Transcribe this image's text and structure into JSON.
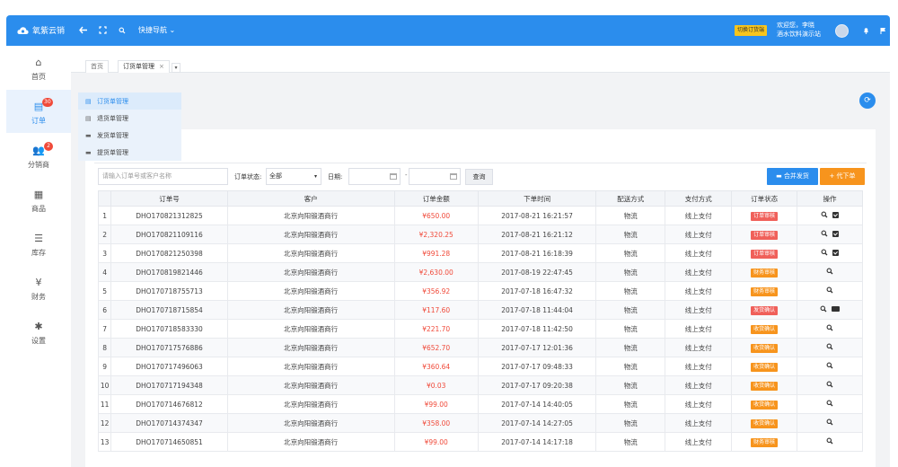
{
  "app": {
    "brand": "氧紫云销",
    "quick_nav": "快捷导航",
    "switch_label": "切换订货端",
    "welcome_line1": "欢迎您，李晓",
    "welcome_line2": "酒水饮料演示站"
  },
  "sidebar": {
    "items": [
      {
        "label": "首页",
        "icon": "home-icon",
        "glyph": "⌂"
      },
      {
        "label": "订单",
        "icon": "order-icon",
        "glyph": "▤",
        "badge": "30"
      },
      {
        "label": "分销商",
        "icon": "distributor-icon",
        "glyph": "👥",
        "badge": "2"
      },
      {
        "label": "商品",
        "icon": "goods-icon",
        "glyph": "▦"
      },
      {
        "label": "库存",
        "icon": "inventory-icon",
        "glyph": "☰"
      },
      {
        "label": "财务",
        "icon": "finance-icon",
        "glyph": "¥"
      },
      {
        "label": "设置",
        "icon": "settings-icon",
        "glyph": "✱"
      }
    ]
  },
  "flyout": {
    "items": [
      {
        "label": "订货单管理",
        "glyph": "▤"
      },
      {
        "label": "退货单管理",
        "glyph": "▤"
      },
      {
        "label": "发货单管理",
        "glyph": "▬"
      },
      {
        "label": "提货单管理",
        "glyph": "▬"
      }
    ]
  },
  "tabs": {
    "home": "首页",
    "current": "订货单管理",
    "close": "×",
    "dropdown": "▾"
  },
  "filters": {
    "search_placeholder": "请输入订单号或客户名称",
    "status_label": "订单状态:",
    "status_value": "全部",
    "date_label": "日期:",
    "dash": "-",
    "query": "查询",
    "merge_ship": "合并发货",
    "proxy_order": "+ 代下单"
  },
  "table": {
    "headers": [
      "",
      "订单号",
      "客户",
      "订单金额",
      "下单时间",
      "配送方式",
      "支付方式",
      "订单状态",
      "操作"
    ],
    "rows": [
      {
        "idx": "1",
        "order_no": "DHO170821312825",
        "customer": "北京向阳锻酒商行",
        "amount": "¥650.00",
        "time": "2017-08-21 16:21:57",
        "delivery": "物流",
        "payment": "线上支付",
        "status": "订单审核",
        "status_color": "#f0605a",
        "ops": [
          "view",
          "check"
        ]
      },
      {
        "idx": "2",
        "order_no": "DHO170821109116",
        "customer": "北京向阳锻酒商行",
        "amount": "¥2,320.25",
        "time": "2017-08-21 16:21:12",
        "delivery": "物流",
        "payment": "线上支付",
        "status": "订单审核",
        "status_color": "#f0605a",
        "ops": [
          "view",
          "check"
        ]
      },
      {
        "idx": "3",
        "order_no": "DHO170821250398",
        "customer": "北京向阳锻酒商行",
        "amount": "¥991.28",
        "time": "2017-08-21 16:18:39",
        "delivery": "物流",
        "payment": "线上支付",
        "status": "订单审核",
        "status_color": "#f0605a",
        "ops": [
          "view",
          "check"
        ]
      },
      {
        "idx": "4",
        "order_no": "DHO170819821446",
        "customer": "北京向阳锻酒商行",
        "amount": "¥2,630.00",
        "time": "2017-08-19 22:47:45",
        "delivery": "物流",
        "payment": "线上支付",
        "status": "财务审核",
        "status_color": "#f7941d",
        "ops": [
          "view"
        ]
      },
      {
        "idx": "5",
        "order_no": "DHO170718755713",
        "customer": "北京向阳锻酒商行",
        "amount": "¥356.92",
        "time": "2017-07-18 16:47:32",
        "delivery": "物流",
        "payment": "线上支付",
        "status": "财务审核",
        "status_color": "#f7941d",
        "ops": [
          "view"
        ]
      },
      {
        "idx": "6",
        "order_no": "DHO170718715854",
        "customer": "北京向阳锻酒商行",
        "amount": "¥117.60",
        "time": "2017-07-18 11:44:04",
        "delivery": "物流",
        "payment": "线上支付",
        "status": "发货确认",
        "status_color": "#f0605a",
        "ops": [
          "view",
          "truck"
        ]
      },
      {
        "idx": "7",
        "order_no": "DHO170718583330",
        "customer": "北京向阳锻酒商行",
        "amount": "¥221.70",
        "time": "2017-07-18 11:42:50",
        "delivery": "物流",
        "payment": "线上支付",
        "status": "收货确认",
        "status_color": "#f7941d",
        "ops": [
          "view"
        ]
      },
      {
        "idx": "8",
        "order_no": "DHO170717576886",
        "customer": "北京向阳锻酒商行",
        "amount": "¥652.70",
        "time": "2017-07-17 12:01:36",
        "delivery": "物流",
        "payment": "线上支付",
        "status": "收货确认",
        "status_color": "#f7941d",
        "ops": [
          "view"
        ]
      },
      {
        "idx": "9",
        "order_no": "DHO170717496063",
        "customer": "北京向阳锻酒商行",
        "amount": "¥360.64",
        "time": "2017-07-17 09:48:33",
        "delivery": "物流",
        "payment": "线上支付",
        "status": "收货确认",
        "status_color": "#f7941d",
        "ops": [
          "view"
        ]
      },
      {
        "idx": "10",
        "order_no": "DHO170717194348",
        "customer": "北京向阳锻酒商行",
        "amount": "¥0.03",
        "time": "2017-07-17 09:20:38",
        "delivery": "物流",
        "payment": "线上支付",
        "status": "收货确认",
        "status_color": "#f7941d",
        "ops": [
          "view"
        ]
      },
      {
        "idx": "11",
        "order_no": "DHO170714676812",
        "customer": "北京向阳锻酒商行",
        "amount": "¥99.00",
        "time": "2017-07-14 14:40:05",
        "delivery": "物流",
        "payment": "线上支付",
        "status": "收货确认",
        "status_color": "#f7941d",
        "ops": [
          "view"
        ]
      },
      {
        "idx": "12",
        "order_no": "DHO170714374347",
        "customer": "北京向阳锻酒商行",
        "amount": "¥358.00",
        "time": "2017-07-14 14:27:05",
        "delivery": "物流",
        "payment": "线上支付",
        "status": "收货确认",
        "status_color": "#f7941d",
        "ops": [
          "view"
        ]
      },
      {
        "idx": "13",
        "order_no": "DHO170714650851",
        "customer": "北京向阳锻酒商行",
        "amount": "¥99.00",
        "time": "2017-07-14 14:17:18",
        "delivery": "物流",
        "payment": "线上支付",
        "status": "财务审核",
        "status_color": "#f7941d",
        "ops": [
          "view"
        ]
      }
    ]
  },
  "colors": {
    "primary": "#2b8ded",
    "orange": "#f7941d",
    "red": "#f04a3a",
    "yellow": "#f7c51d"
  }
}
